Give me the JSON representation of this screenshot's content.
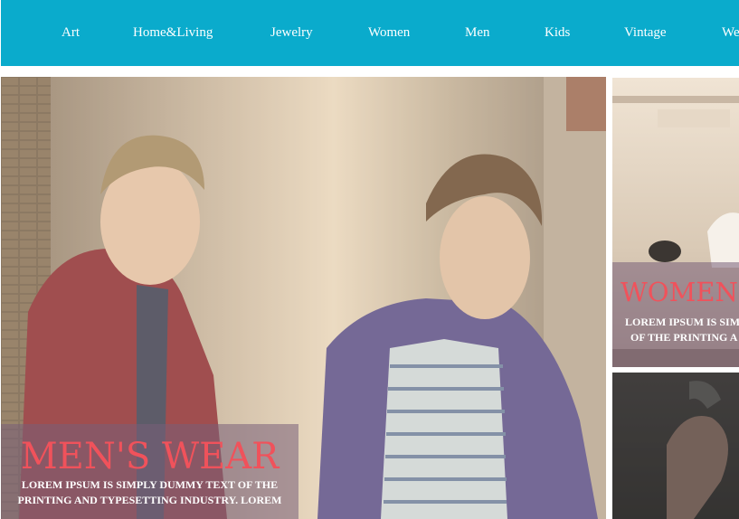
{
  "nav": {
    "items": [
      "Art",
      "Home&Living",
      "Jewelry",
      "Women",
      "Men",
      "Kids",
      "Vintage",
      "We"
    ]
  },
  "hero": {
    "title": "MEN'S WEAR",
    "text_line1": "LOREM IPSUM IS SIMPLY DUMMY TEXT OF THE",
    "text_line2": "PRINTING AND TYPESETTING INDUSTRY. LOREM",
    "image": "two-men-photo"
  },
  "side_top": {
    "title": "WOMEN'",
    "text_line1": "LOREM IPSUM IS SIM",
    "text_line2": "OF THE PRINTING A",
    "image": "womens-fashion-photo"
  },
  "side_bottom": {
    "image": "accessories-photo"
  }
}
